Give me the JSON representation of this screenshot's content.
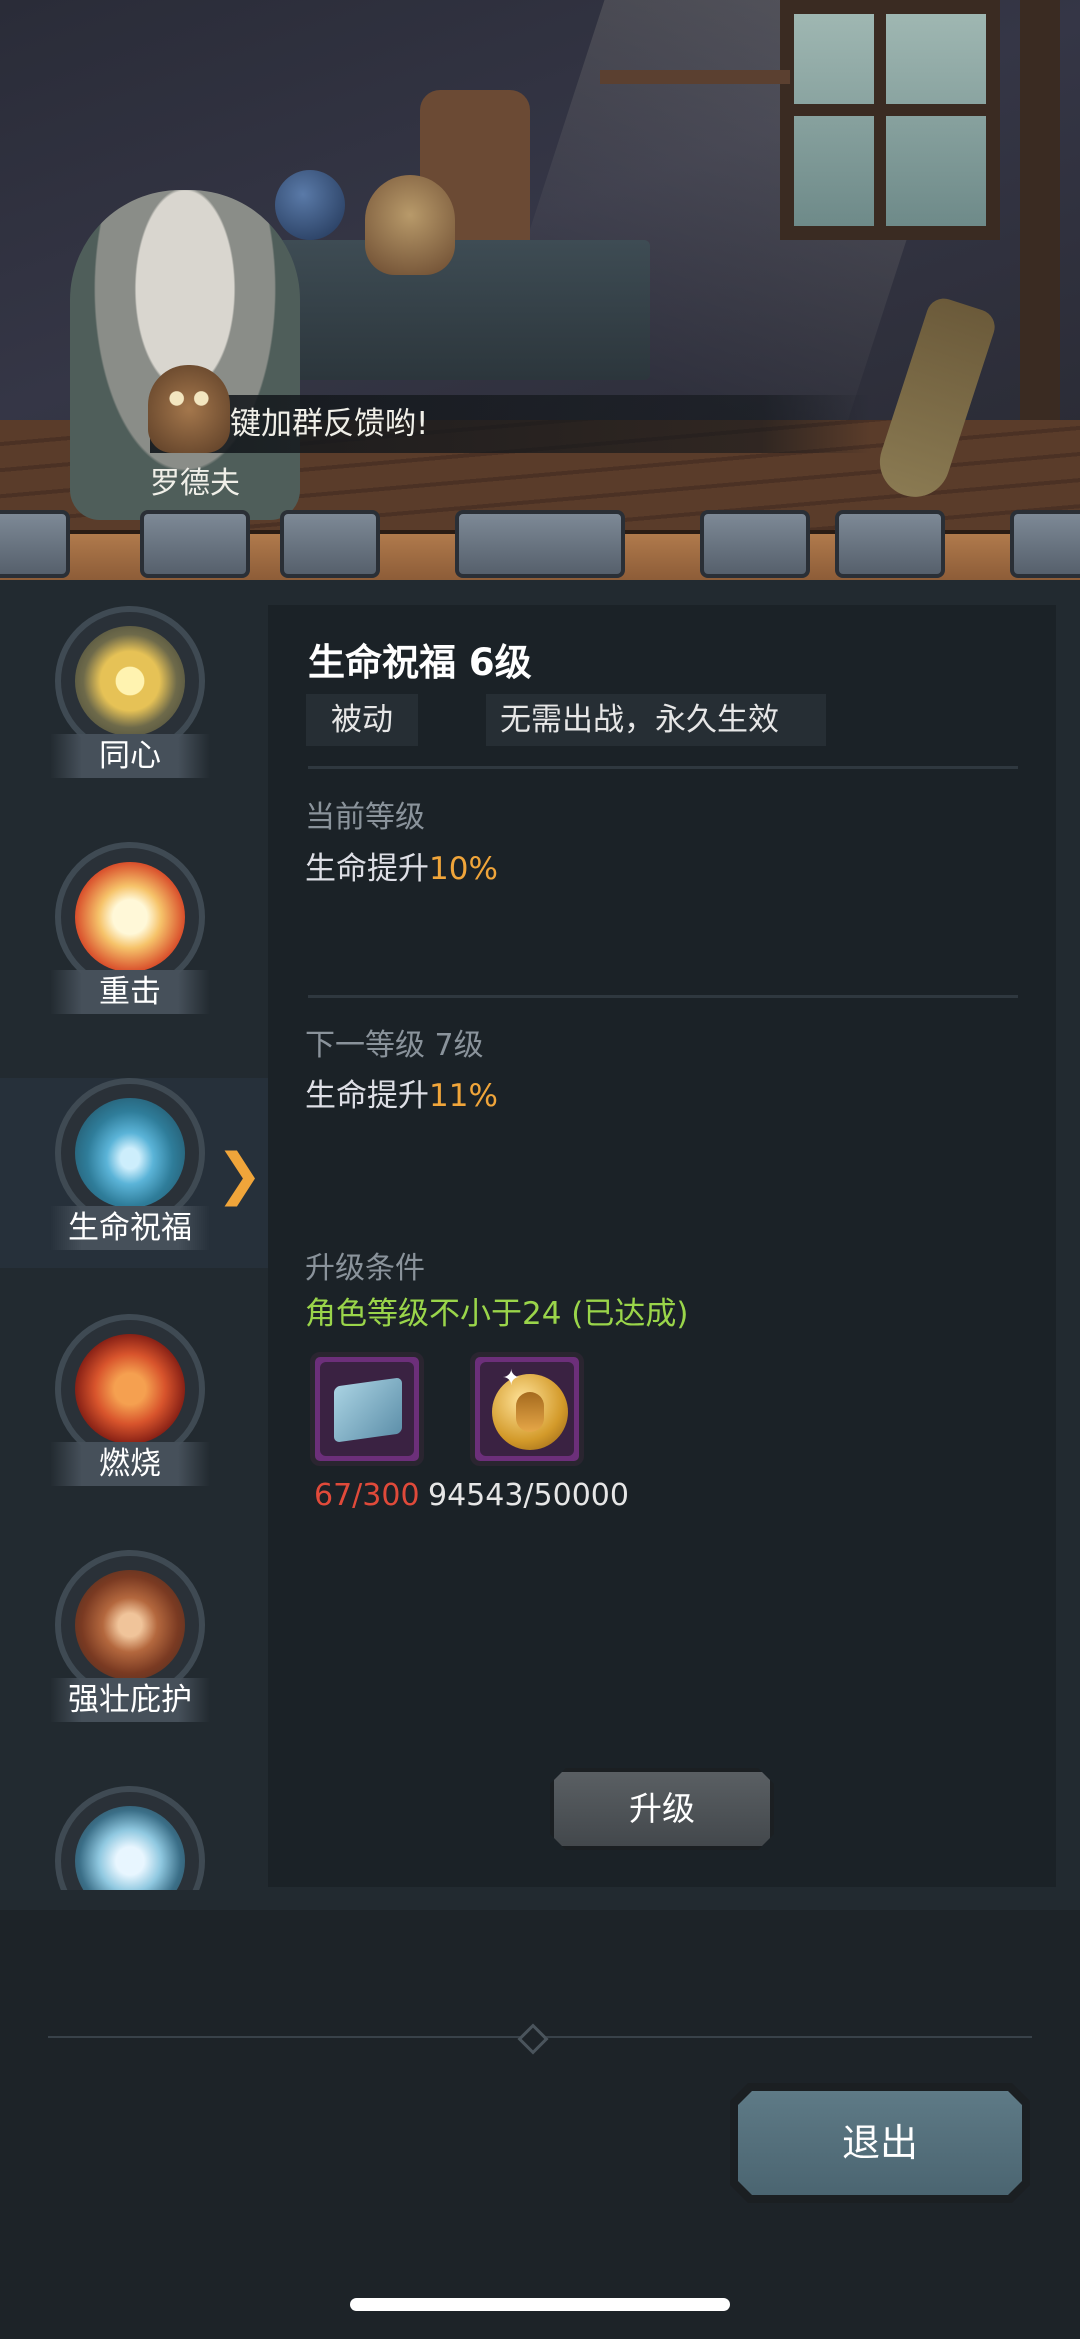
{
  "dialogue": {
    "text": "键加群反馈哟!",
    "speaker": "罗德夫"
  },
  "skills": [
    {
      "label": "同心",
      "icon": "sun-star-icon"
    },
    {
      "label": "重击",
      "icon": "burst-icon"
    },
    {
      "label": "生命祝福",
      "icon": "water-drop-icon",
      "selected": true
    },
    {
      "label": "燃烧",
      "icon": "fire-swirl-icon"
    },
    {
      "label": "强壮庇护",
      "icon": "shield-rock-icon"
    },
    {
      "label": "",
      "icon": "frost-burst-icon"
    }
  ],
  "detail": {
    "title": "生命祝福 6级",
    "tag_type": "被动",
    "tag_desc": "无需出战，永久生效",
    "current_label": "当前等级",
    "current_effect_prefix": "生命提升",
    "current_effect_value": "10%",
    "next_label": "下一等级 7级",
    "next_effect_prefix": "生命提升",
    "next_effect_value": "11%",
    "condition_label": "升级条件",
    "condition_text": "角色等级不小于24 (已达成)",
    "materials": [
      {
        "icon": "scroll-map-icon",
        "count": "67/300",
        "sufficient": false
      },
      {
        "icon": "gold-coin-icon",
        "count": "94543/50000",
        "sufficient": true
      }
    ],
    "upgrade_label": "升级"
  },
  "footer": {
    "exit_label": "退出"
  },
  "colors": {
    "accent_orange": "#f0a53a",
    "ok_green": "#9ad54a",
    "insufficient_red": "#e04a3a"
  }
}
